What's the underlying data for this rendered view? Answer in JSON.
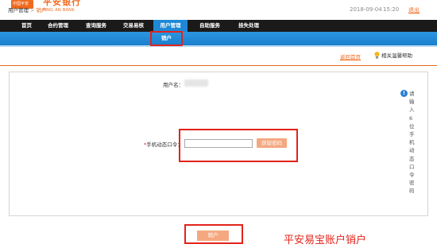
{
  "header": {
    "logo_badge": "中国平安",
    "logo_cn": "平安银行",
    "logo_en": "PING AN BANK",
    "date": "2018-09-04",
    "time": "15:20",
    "exit_label": "退出"
  },
  "nav": {
    "items": [
      {
        "label": "首页"
      },
      {
        "label": "合约管理"
      },
      {
        "label": "查询服务"
      },
      {
        "label": "交易易核"
      },
      {
        "label": "用户管理"
      },
      {
        "label": "自助服务"
      },
      {
        "label": "挂失处理"
      }
    ],
    "active_index": 4,
    "sub_item": "销户"
  },
  "breadcrumb": {
    "root": "用户管理",
    "separator": ">",
    "current": "销户"
  },
  "actions": {
    "back_home": "返回首页",
    "help": "相关温馨帮助"
  },
  "form": {
    "username_label": "用户名：",
    "otp_required_mark": "*",
    "otp_label": "手机动态口令：",
    "otp_value": "",
    "get_code_button": "获取密码",
    "tip_text": "请输入6位手机动态口令密码",
    "submit_label": "销户"
  },
  "caption": "平安易宝账户销户",
  "colors": {
    "brand_orange": "#f06a1e",
    "nav_bg": "#1a1a1a",
    "nav_active": "#1e88d6",
    "highlight_red": "#e2231a"
  }
}
